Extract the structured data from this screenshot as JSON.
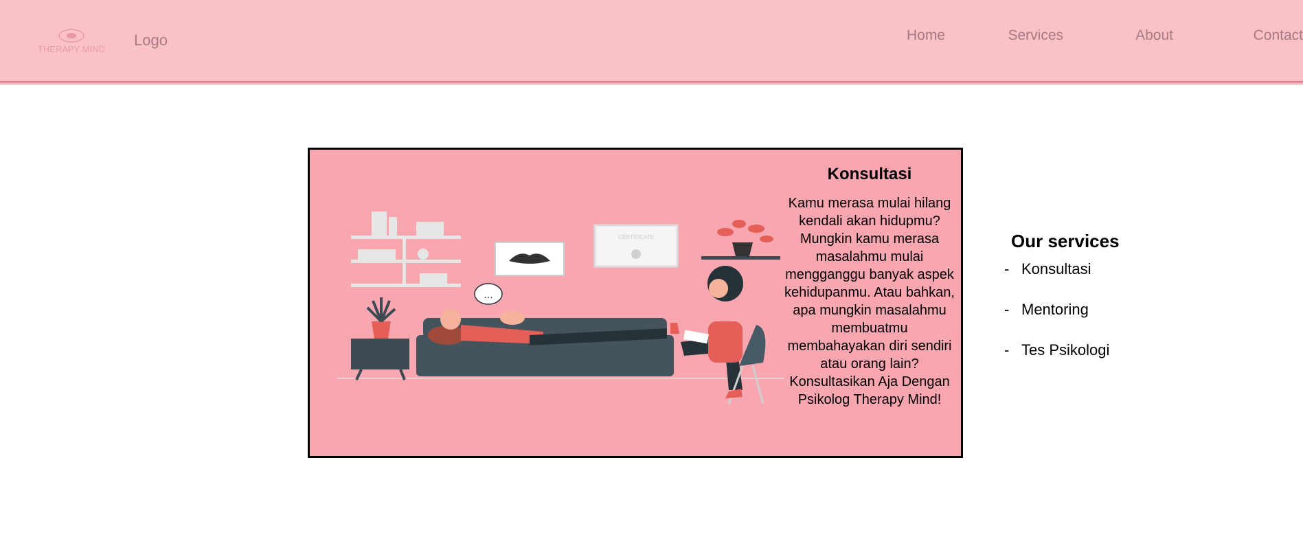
{
  "header": {
    "brand_mark_text": "THERAPY MIND",
    "logo_label": "Logo",
    "nav": [
      {
        "label": "Home"
      },
      {
        "label": "Services"
      },
      {
        "label": "About"
      },
      {
        "label": "Contact"
      }
    ],
    "colors": {
      "background": "#fbc1c8",
      "text": "#a57b80"
    }
  },
  "card": {
    "title": "Konsultasi",
    "body": "Kamu merasa mulai hilang kendali akan hidupmu? Mungkin kamu merasa masalahmu mulai mengganggu banyak aspek kehidupanmu. Atau bahkan, apa mungkin masalahmu membuatmu membahayakan diri sendiri atau orang lain? Konsultasikan Aja Dengan Psikolog Therapy Mind!",
    "illustration": {
      "certificate_label": "CERTIFICATE",
      "speech_bubble": "..."
    },
    "background_color": "#f8a6b0"
  },
  "services": {
    "title": "Our services",
    "items": [
      {
        "bullet": "-",
        "label": "Konsultasi"
      },
      {
        "bullet": "-",
        "label": "Mentoring"
      },
      {
        "bullet": "-",
        "label": "Tes Psikologi"
      }
    ]
  }
}
